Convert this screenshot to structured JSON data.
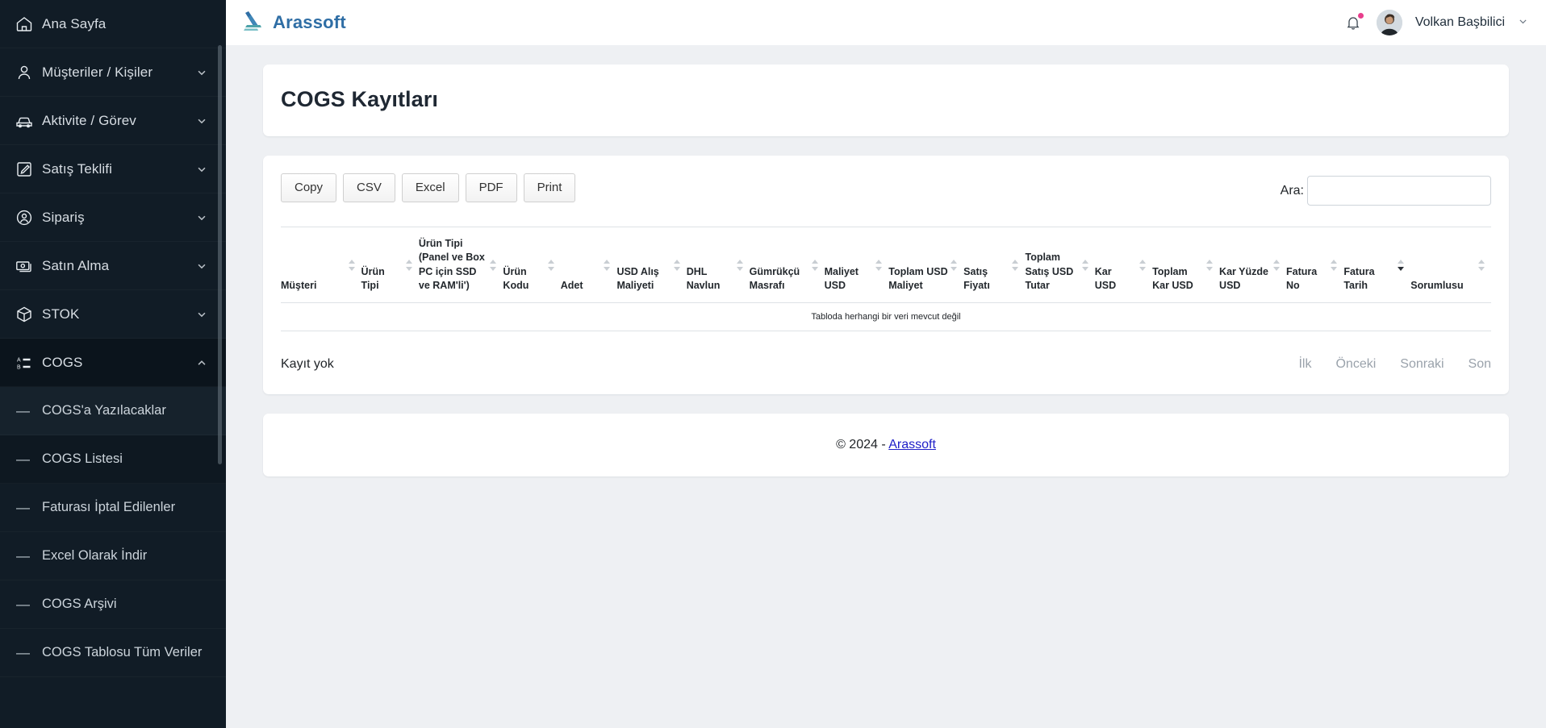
{
  "topbar": {
    "brand": "Arassoft",
    "brand_icon": "arassoft-logo-icon",
    "bell_icon": "bell-icon",
    "user_name": "Volkan Başbilici",
    "user_chevron": "chevron-down-icon"
  },
  "sidebar": {
    "items": [
      {
        "label": "Ana Sayfa",
        "icon": "home-icon",
        "chevron": "",
        "active": false
      },
      {
        "label": "Müşteriler / Kişiler",
        "icon": "user-icon",
        "chevron": "v",
        "active": false
      },
      {
        "label": "Aktivite / Görev",
        "icon": "car-icon",
        "chevron": "v",
        "active": false
      },
      {
        "label": "Satış Teklifi",
        "icon": "edit-note-icon",
        "chevron": "v",
        "active": false
      },
      {
        "label": "Sipariş",
        "icon": "user-circle-icon",
        "chevron": "v",
        "active": false
      },
      {
        "label": "Satın Alma",
        "icon": "money-icon",
        "chevron": "v",
        "active": false
      },
      {
        "label": "STOK",
        "icon": "cube-icon",
        "chevron": "v",
        "active": false
      },
      {
        "label": "COGS",
        "icon": "list-ab-icon",
        "chevron": "^",
        "active": true
      }
    ],
    "subitems": [
      {
        "label": "COGS'a Yazılacaklar",
        "state": "hover"
      },
      {
        "label": "COGS Listesi",
        "state": "selected"
      },
      {
        "label": "Faturası İptal Edilenler",
        "state": ""
      },
      {
        "label": "Excel Olarak İndir",
        "state": ""
      },
      {
        "label": "COGS Arşivi",
        "state": ""
      },
      {
        "label": "COGS Tablosu Tüm Veriler",
        "state": ""
      }
    ]
  },
  "page": {
    "title": "COGS Kayıtları"
  },
  "toolbar": {
    "buttons": [
      "Copy",
      "CSV",
      "Excel",
      "PDF",
      "Print"
    ],
    "search_label": "Ara:",
    "search_value": "",
    "search_placeholder": ""
  },
  "table": {
    "columns": [
      {
        "label": "Müşteri",
        "sort": "none"
      },
      {
        "label": "Ürün Tipi",
        "sort": "none"
      },
      {
        "label": "Ürün Tipi (Panel ve Box PC için SSD ve RAM'li')",
        "sort": "none"
      },
      {
        "label": "Ürün Kodu",
        "sort": "none"
      },
      {
        "label": "Adet",
        "sort": "none"
      },
      {
        "label": "USD Alış Maliyeti",
        "sort": "none"
      },
      {
        "label": "DHL Navlun",
        "sort": "none"
      },
      {
        "label": "Gümrükçü Masrafı",
        "sort": "none"
      },
      {
        "label": "Maliyet USD",
        "sort": "none"
      },
      {
        "label": "Toplam USD Maliyet",
        "sort": "none"
      },
      {
        "label": "Satış Fiyatı",
        "sort": "none"
      },
      {
        "label": "Toplam Satış USD Tutar",
        "sort": "none"
      },
      {
        "label": "Kar USD",
        "sort": "none"
      },
      {
        "label": "Toplam Kar USD",
        "sort": "none"
      },
      {
        "label": "Kar Yüzde USD",
        "sort": "none"
      },
      {
        "label": "Fatura No",
        "sort": "none"
      },
      {
        "label": "Fatura Tarih",
        "sort": "desc"
      },
      {
        "label": "Sorumlusu",
        "sort": "none"
      }
    ],
    "rows": [],
    "empty_message": "Tabloda herhangi bir veri mevcut değil",
    "info": "Kayıt yok",
    "pagination": [
      "İlk",
      "Önceki",
      "Sonraki",
      "Son"
    ]
  },
  "footer": {
    "copyright": "© 2024 - ",
    "link": "Arassoft"
  },
  "colors": {
    "sidebar_bg": "#111c26",
    "brand_blue": "#2f6ea5",
    "content_bg": "#eef0f3",
    "notification_dot": "#e83e8c",
    "link_blue": "#2020c8"
  }
}
